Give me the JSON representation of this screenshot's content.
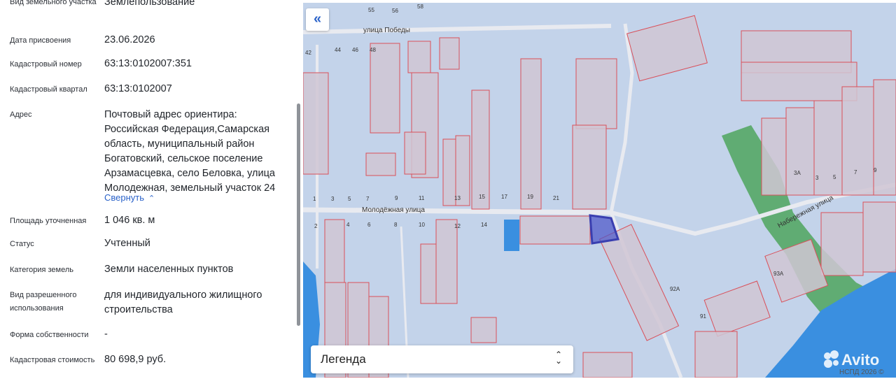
{
  "panel": {
    "rows": [
      {
        "label": "Вид земельного участка",
        "value": "Землепользование"
      },
      {
        "label": "Дата присвоения",
        "value": "23.06.2026"
      },
      {
        "label": "Кадастровый номер",
        "value": "63:13:0102007:351"
      },
      {
        "label": "Кадастровый квартал",
        "value": "63:13:0102007"
      },
      {
        "label": "Адрес",
        "value": "Почтовый адрес ориентира: Российская Федерация,Самарская область, муниципальный район Богатовский, сельское поселение Арзамасцевка, село Беловка, улица Молодежная, земельный участок 24"
      },
      {
        "label": "Площадь уточненная",
        "value": "1 046 кв. м"
      },
      {
        "label": "Статус",
        "value": "Учтенный"
      },
      {
        "label": "Категория земель",
        "value": "Земли населенных пунктов"
      },
      {
        "label": "Вид разрешенного использования",
        "value": "для индивидуального жилищного строительства"
      },
      {
        "label": "Форма собственности",
        "value": "-"
      },
      {
        "label": "Кадастровая стоимость",
        "value": "80 698,9 руб."
      }
    ],
    "collapse_link": "Свернуть"
  },
  "map": {
    "collapse_button_icon": "double-chevron-left-icon",
    "streets": {
      "pobedy": "улица Победы",
      "molodezhnaya": "Молодёжная улица",
      "naberezhnaya": "Набережная улица"
    },
    "house_numbers": [
      "55",
      "56",
      "58",
      "42",
      "44",
      "46",
      "48",
      "9",
      "11",
      "13",
      "15",
      "17",
      "19",
      "21",
      "1",
      "3",
      "5",
      "7",
      "2",
      "4",
      "6",
      "8",
      "10",
      "12",
      "14",
      "3А",
      "3",
      "5",
      "7",
      "9",
      "93А",
      "92А",
      "91"
    ],
    "legend_label": "Легенда",
    "copyright": "НСПД 2026 ©",
    "watermark": "Avito",
    "colors": {
      "background": "#c3d3ea",
      "parcel_fill": "#d0c6d4",
      "parcel_border": "#d9505a",
      "selected_parcel": "#4a52c8",
      "green": "#4fa55e",
      "water": "#3a8fe0",
      "accent": "#2a62c9"
    }
  }
}
